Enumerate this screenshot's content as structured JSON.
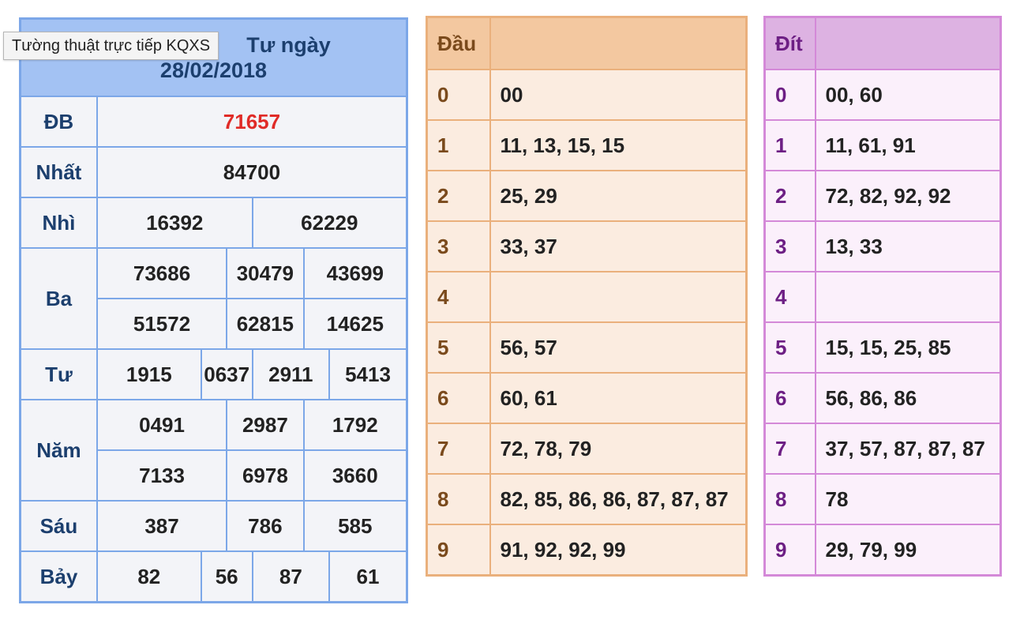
{
  "tooltip": "Tường thuật trực tiếp KQXS",
  "results": {
    "title_line1": "Tường thuật trực tiếp KQXS Thứ Tư ngày",
    "title_visible_suffix": "Tư ngày",
    "title_line2": "28/02/2018",
    "prizes": {
      "db": {
        "label": "ĐB",
        "values": [
          "71657"
        ]
      },
      "nhat": {
        "label": "Nhất",
        "values": [
          "84700"
        ]
      },
      "nhi": {
        "label": "Nhì",
        "values": [
          "16392",
          "62229"
        ]
      },
      "ba": {
        "label": "Ba",
        "values": [
          "73686",
          "30479",
          "43699",
          "51572",
          "62815",
          "14625"
        ]
      },
      "tu": {
        "label": "Tư",
        "values": [
          "1915",
          "0637",
          "2911",
          "5413"
        ]
      },
      "nam": {
        "label": "Năm",
        "values": [
          "0491",
          "2987",
          "1792",
          "7133",
          "6978",
          "3660"
        ]
      },
      "sau": {
        "label": "Sáu",
        "values": [
          "387",
          "786",
          "585"
        ]
      },
      "bay": {
        "label": "Bảy",
        "values": [
          "82",
          "56",
          "87",
          "61"
        ]
      }
    }
  },
  "dau": {
    "header": "Đầu",
    "header_value": "",
    "rows": [
      {
        "key": "0",
        "value": "00"
      },
      {
        "key": "1",
        "value": "11, 13, 15, 15"
      },
      {
        "key": "2",
        "value": "25, 29"
      },
      {
        "key": "3",
        "value": "33, 37"
      },
      {
        "key": "4",
        "value": ""
      },
      {
        "key": "5",
        "value": "56, 57"
      },
      {
        "key": "6",
        "value": "60, 61"
      },
      {
        "key": "7",
        "value": "72, 78, 79"
      },
      {
        "key": "8",
        "value": "82, 85, 86, 86, 87, 87, 87"
      },
      {
        "key": "9",
        "value": "91, 92, 92, 99"
      }
    ]
  },
  "dit": {
    "header": "Đít",
    "header_value": "",
    "rows": [
      {
        "key": "0",
        "value": "00, 60"
      },
      {
        "key": "1",
        "value": "11, 61, 91"
      },
      {
        "key": "2",
        "value": "72, 82, 92, 92"
      },
      {
        "key": "3",
        "value": "13, 33"
      },
      {
        "key": "4",
        "value": ""
      },
      {
        "key": "5",
        "value": "15, 15, 25, 85"
      },
      {
        "key": "6",
        "value": "56, 86, 86"
      },
      {
        "key": "7",
        "value": "37, 57, 87, 87, 87"
      },
      {
        "key": "8",
        "value": "78"
      },
      {
        "key": "9",
        "value": "29, 79, 99"
      }
    ]
  },
  "colors": {
    "results_border": "#7ca7e8",
    "results_header_bg": "#a3c2f3",
    "special_prize": "#e02b27",
    "dau_border": "#eab07c",
    "dit_border": "#d489d8"
  }
}
